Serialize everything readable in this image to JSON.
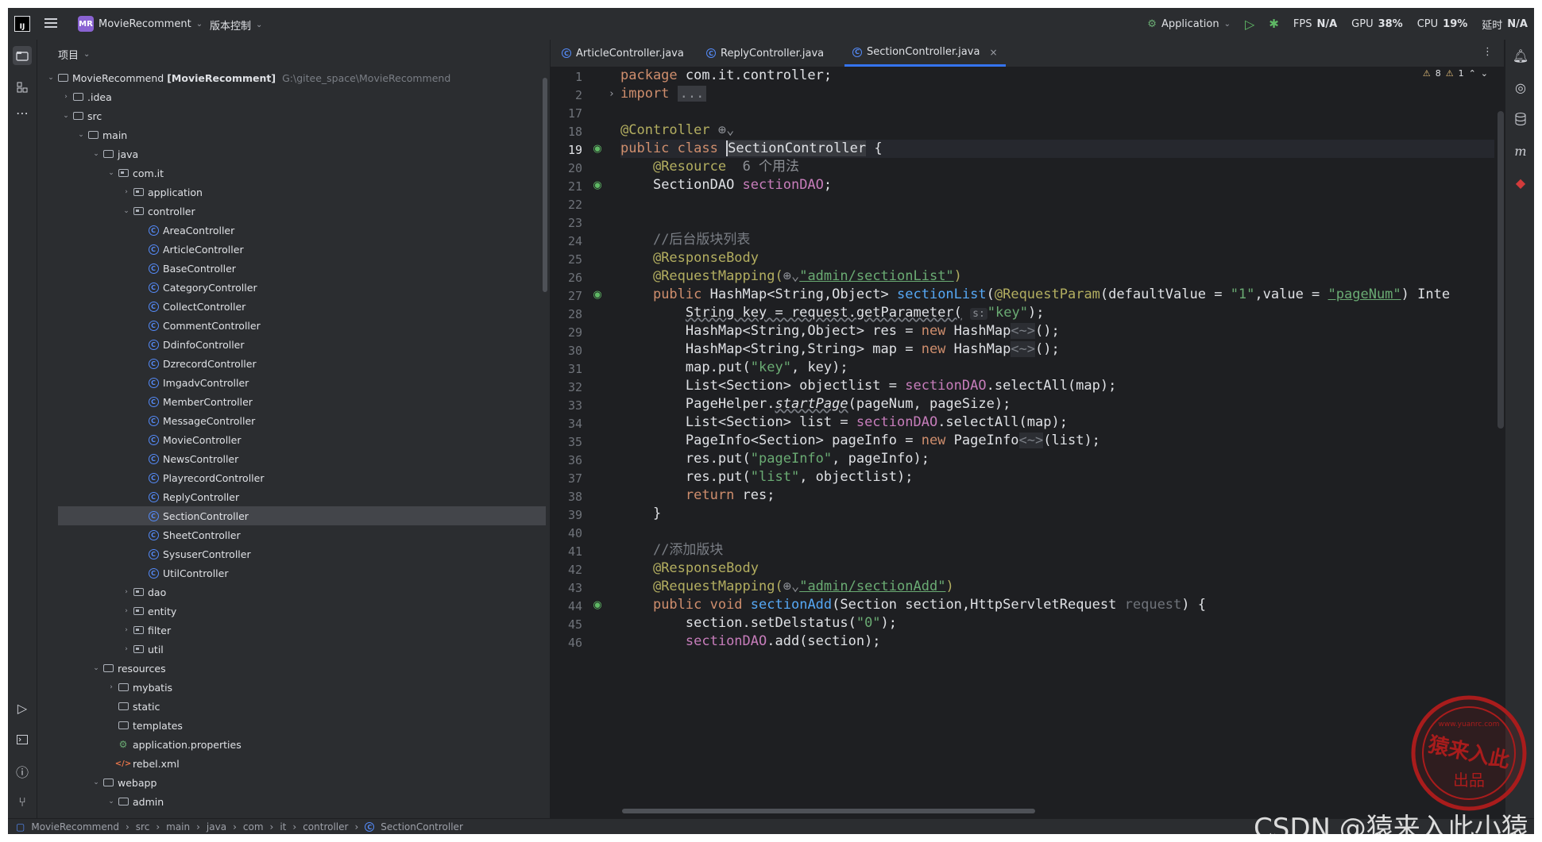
{
  "titlebar": {
    "project_badge": "MR",
    "project_name": "MovieRecomment",
    "vcs": "版本控制",
    "run_config": "Application",
    "fps_label": "FPS",
    "fps_value": "N/A",
    "gpu_label": "GPU",
    "gpu_value": "38%",
    "cpu_label": "CPU",
    "cpu_value": "19%",
    "time_label": "延时",
    "time_value": "N/A"
  },
  "project_panel": {
    "title": "项目",
    "root_name": "MovieRecommend",
    "root_module": "[MovieRecomment]",
    "root_path": "G:\\gitee_space\\MovieRecommend",
    "tree": [
      ".idea",
      "src",
      "main",
      "java",
      "com.it",
      "application",
      "controller",
      "AreaController",
      "ArticleController",
      "BaseController",
      "CategoryController",
      "CollectController",
      "CommentController",
      "DdinfoController",
      "DzrecordController",
      "ImgadvController",
      "MemberController",
      "MessageController",
      "MovieController",
      "NewsController",
      "PlayrecordController",
      "ReplyController",
      "SectionController",
      "SheetController",
      "SysuserController",
      "UtilController",
      "dao",
      "entity",
      "filter",
      "util",
      "resources",
      "mybatis",
      "static",
      "templates",
      "application.properties",
      "rebel.xml",
      "webapp",
      "admin"
    ]
  },
  "editor": {
    "tabs": [
      "ArticleController.java",
      "ReplyController.java",
      "SectionController.java"
    ],
    "warnings": "8",
    "weak_warnings": "1",
    "line_numbers": [
      "1",
      "2",
      "17",
      "18",
      "19",
      "20",
      "21",
      "22",
      "23",
      "24",
      "25",
      "26",
      "27",
      "28",
      "29",
      "30",
      "31",
      "32",
      "33",
      "34",
      "35",
      "36",
      "37",
      "38",
      "39",
      "40",
      "41",
      "42",
      "43",
      "44",
      "45",
      "46"
    ],
    "code": {
      "l1_kw": "package",
      "l1_rest": " com.it.controller;",
      "l2_kw": "import",
      "l2_fold": "...",
      "l18": "@Controller",
      "l19_kw": "public class",
      "l19_cls": "SectionController",
      "l19_rest": " {",
      "l20_ann": "@Resource",
      "l20_hint": "6 个用法",
      "l21_type": "SectionDAO ",
      "l21_fld": "sectionDAO",
      "l21_end": ";",
      "l24": "//后台版块列表",
      "l25": "@ResponseBody",
      "l26_ann": "@RequestMapping(",
      "l26_str": "\"admin/sectionList\"",
      "l26_end": ")",
      "l27_kw": "public",
      "l27_type": " HashMap<String,Object> ",
      "l27_fn": "sectionList",
      "l27_a": "(",
      "l27_ann": "@RequestParam",
      "l27_b": "(defaultValue = ",
      "l27_s1": "\"1\"",
      "l27_c": ",value = ",
      "l27_s2": "\"pageNum\"",
      "l27_d": ") Inte",
      "l28_a": "String key = request.getParameter(",
      "l28_inlay": "s:",
      "l28_str": "\"key\"",
      "l28_end": ");",
      "l29_a": "HashMap<String,Object> res = ",
      "l29_kw": "new",
      "l29_b": " HashMap",
      "l29_gen": "<~>",
      "l29_end": "();",
      "l30_a": "HashMap<String,String> map = ",
      "l30_kw": "new",
      "l30_b": " HashMap",
      "l30_gen": "<~>",
      "l30_end": "();",
      "l31_a": "map.put(",
      "l31_str": "\"key\"",
      "l31_end": ", key);",
      "l32_a": "List<Section> objectlist = ",
      "l32_fld": "sectionDAO",
      "l32_end": ".selectAll(map);",
      "l33_a": "PageHelper.",
      "l33_it": "startPage",
      "l33_end": "(pageNum, pageSize);",
      "l34_a": "List<Section> list = ",
      "l34_fld": "sectionDAO",
      "l34_end": ".selectAll(map);",
      "l35_a": "PageInfo<Section> pageInfo = ",
      "l35_kw": "new",
      "l35_b": " PageInfo",
      "l35_gen": "<~>",
      "l35_end": "(list);",
      "l36_a": "res.put(",
      "l36_str": "\"pageInfo\"",
      "l36_end": ", pageInfo);",
      "l37_a": "res.put(",
      "l37_str": "\"list\"",
      "l37_end": ", objectlist);",
      "l38_kw": "return",
      "l38_end": " res;",
      "l39": "}",
      "l41": "//添加版块",
      "l42": "@ResponseBody",
      "l43_ann": "@RequestMapping(",
      "l43_str": "\"admin/sectionAdd\"",
      "l43_end": ")",
      "l44_kw": "public void",
      "l44_fn": "sectionAdd",
      "l44_a": "(Section section,HttpServletRequest ",
      "l44_p": "request",
      "l44_end": ") {",
      "l45_a": "section.setDelstatus(",
      "l45_str": "\"0\"",
      "l45_end": ");",
      "l46_fld": "sectionDAO",
      "l46_end": ".add(section);"
    }
  },
  "statusbar": {
    "breadcrumb": [
      "MovieRecommend",
      "src",
      "main",
      "java",
      "com",
      "it",
      "controller",
      "SectionController"
    ]
  },
  "watermark": {
    "stamp_url": "www.yuanrc.com",
    "stamp_main": "猿来入此",
    "stamp_sub": "出品",
    "csdn": "CSDN @猿来入此小猿"
  }
}
